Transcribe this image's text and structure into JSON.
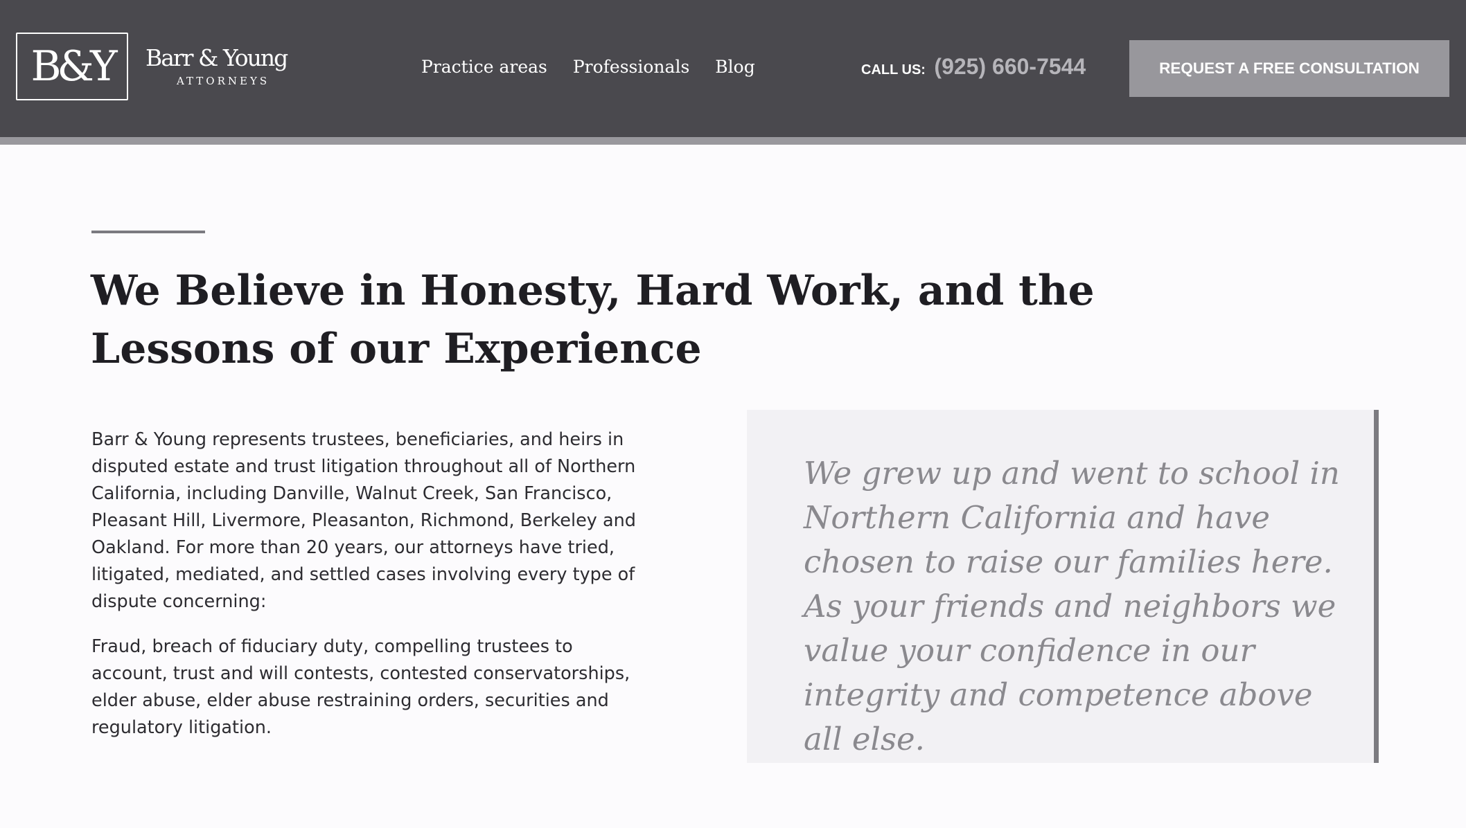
{
  "header": {
    "logo_mark": "B&Y",
    "logo_name": "Barr & Young",
    "logo_sub": "ATTORNEYS",
    "nav": [
      "Practice areas",
      "Professionals",
      "Blog"
    ],
    "call_label": "CALL US:",
    "phone": "(925) 660-7544",
    "cta_label": "REQUEST A FREE CONSULTATION"
  },
  "main": {
    "title": "We Believe in Honesty, Hard Work, and the Lessons of our Experience",
    "paragraph_1": "Barr & Young represents trustees, beneficiaries, and heirs in disputed estate and trust litigation throughout all of Northern California, including Danville, Walnut Creek, San Francisco, Pleasant Hill, Livermore, Pleasanton, Richmond, Berkeley and Oakland. For more than 20 years, our attorneys have tried, litigated, mediated, and settled cases involving every type of dispute concerning:",
    "paragraph_2": "Fraud, breach of fiduciary duty, compelling trustees to account, trust and will contests, contested conservatorships, elder abuse, elder abuse restraining orders, securities and regulatory litigation.",
    "quote": "We grew up and went to school in Northern California and have chosen to raise our families here. As your friends and neighbors we value your confidence in our integrity and competence above all else."
  },
  "colors": {
    "header_bg": "#4a494e",
    "cta_bg": "#98979c",
    "quote_bg": "#f2f1f4",
    "quote_text": "#8a898e"
  }
}
